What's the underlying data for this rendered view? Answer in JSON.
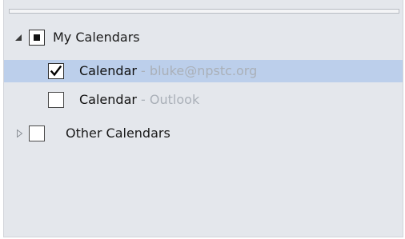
{
  "pane": {
    "groups": [
      {
        "label": "My Calendars",
        "expanded": true,
        "check_state": "partial",
        "items": [
          {
            "name": "Calendar",
            "separator": " - ",
            "account": "bluke@npstc.org",
            "checked": true,
            "selected": true
          },
          {
            "name": "Calendar",
            "separator": " - ",
            "account": "Outlook",
            "checked": false,
            "selected": false
          }
        ]
      },
      {
        "label": "Other Calendars",
        "expanded": false,
        "check_state": "unchecked",
        "items": []
      }
    ]
  },
  "icons": {
    "expanded": "triangle-down-right-icon",
    "collapsed": "triangle-right-outline-icon",
    "check": "checkmark-icon"
  },
  "colors": {
    "pane_bg": "#e4e7ec",
    "selection_bg": "#bccfeb",
    "secondary_text": "#aab0b8"
  }
}
